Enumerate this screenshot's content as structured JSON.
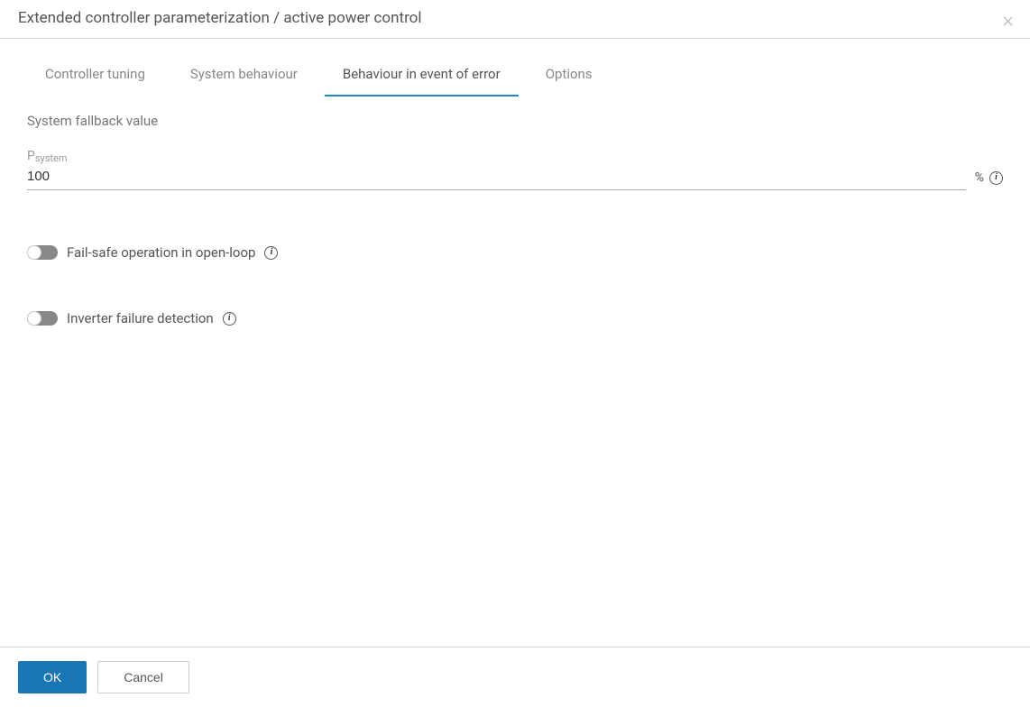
{
  "header": {
    "title": "Extended controller parameterization / active power control"
  },
  "tabs": [
    {
      "label": "Controller tuning",
      "active": false
    },
    {
      "label": "System behaviour",
      "active": false
    },
    {
      "label": "Behaviour in event of error",
      "active": true
    },
    {
      "label": "Options",
      "active": false
    }
  ],
  "section": {
    "title": "System fallback value"
  },
  "fields": {
    "psystem": {
      "label_main": "P",
      "label_sub": "system",
      "value": "100",
      "unit": "%"
    }
  },
  "toggles": {
    "fail_safe": {
      "label": "Fail-safe operation in open-loop",
      "state": false
    },
    "inverter_failure": {
      "label": "Inverter failure detection",
      "state": false
    }
  },
  "footer": {
    "ok_label": "OK",
    "cancel_label": "Cancel"
  }
}
